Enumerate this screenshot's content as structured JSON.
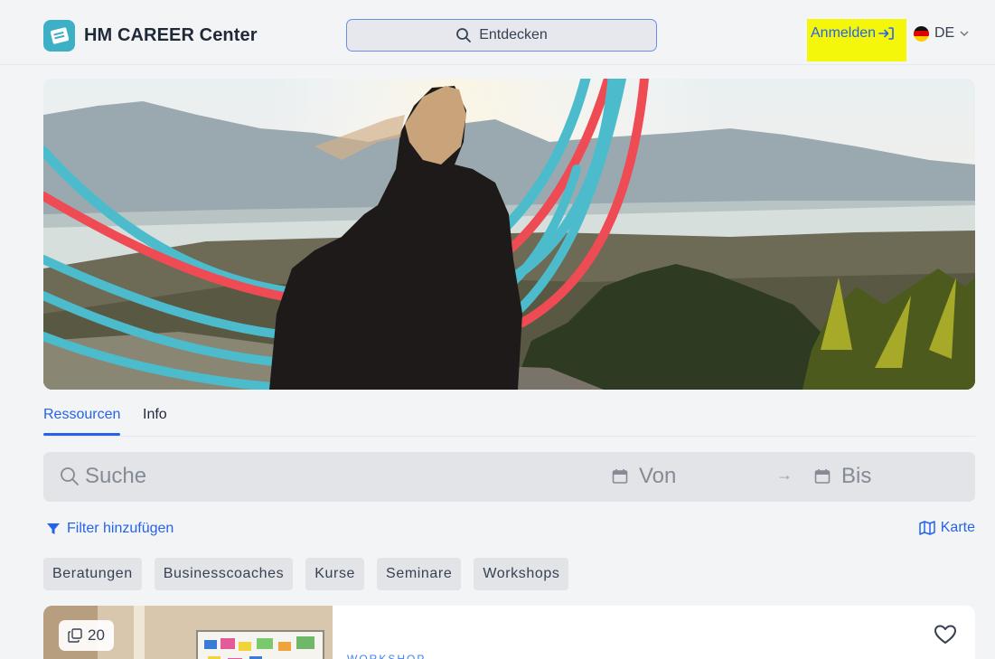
{
  "header": {
    "brand": "HM CAREER Center",
    "explore_label": "Entdecken",
    "login_label": "Anmelden",
    "language": "DE",
    "highlight_color": "#f4f70a"
  },
  "tabs": [
    {
      "label": "Ressourcen",
      "active": true
    },
    {
      "label": "Info",
      "active": false
    }
  ],
  "search": {
    "placeholder": "Suche",
    "from_label": "Von",
    "to_label": "Bis"
  },
  "filter_label": "Filter hinzufügen",
  "map_label": "Karte",
  "categories": [
    "Beratungen",
    "Businesscoaches",
    "Kurse",
    "Seminare",
    "Workshops"
  ],
  "card": {
    "count": "20",
    "type": "WORKSHOP"
  },
  "colors": {
    "accent": "#2563eb",
    "brand_teal": "#3db0c6",
    "hero_red": "#ef4b54",
    "hero_teal": "#4cbccd"
  }
}
